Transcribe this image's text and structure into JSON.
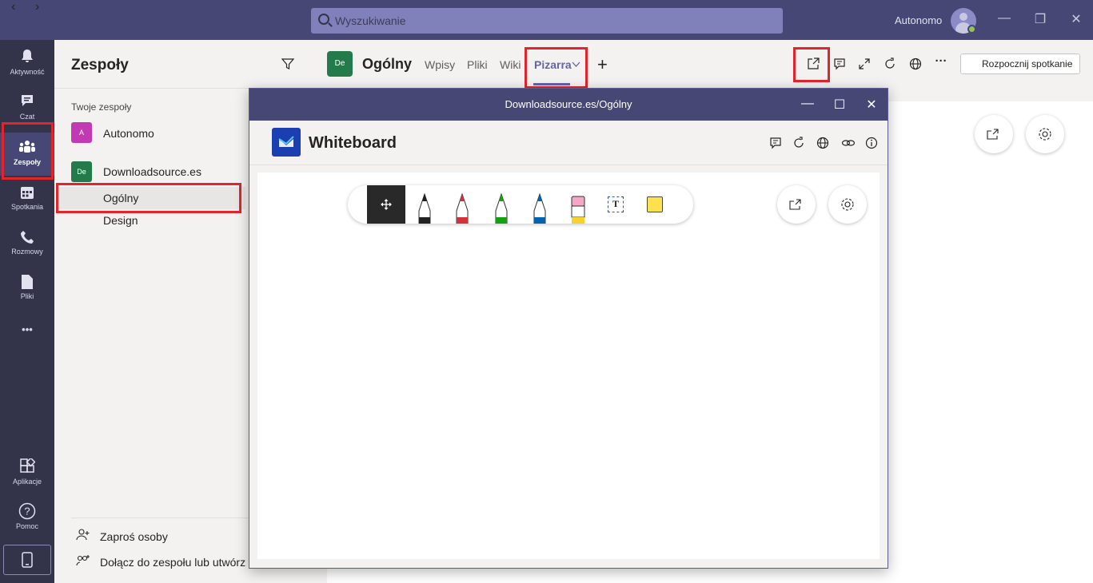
{
  "app": {
    "search_placeholder": "Wyszukiwanie",
    "user_name": "Autonomo"
  },
  "rail": {
    "items": [
      {
        "label": "Aktywność"
      },
      {
        "label": "Czat"
      },
      {
        "label": "Zespoły"
      },
      {
        "label": "Spotkania"
      },
      {
        "label": "Rozmowy"
      },
      {
        "label": "Pliki"
      },
      {
        "label": "Aplikacje"
      },
      {
        "label": "Pomoc"
      }
    ],
    "more": "•••"
  },
  "teams": {
    "title": "Zespoły",
    "section_label": "Twoje zespoły",
    "list": [
      {
        "initials": "A",
        "name": "Autonomo",
        "color": "#c239b3"
      },
      {
        "initials": "De",
        "name": "Downloadsource.es",
        "color": "#237b4b"
      }
    ],
    "channels": [
      "Ogólny",
      "Design"
    ],
    "invite_label": "Zaproś osoby",
    "join_label": "Dołącz do zespołu lub utwórz"
  },
  "channel": {
    "initials": "De",
    "title": "Ogólny",
    "tabs": [
      "Wpisy",
      "Pliki",
      "Wiki",
      "Pizarra"
    ],
    "add_tab": "+",
    "meeting_button": "Rozpocznij spotkanie"
  },
  "popup": {
    "window_title": "Downloadsource.es/Ogólny",
    "app_title": "Whiteboard"
  },
  "colors": {
    "accent": "#6264a7",
    "titlebar": "#464775",
    "rail": "#33344a",
    "highlight": "#e3242b"
  },
  "toolbar": {
    "text_tool": "T",
    "pens": [
      "black",
      "red",
      "green",
      "blue",
      "eraser"
    ]
  }
}
